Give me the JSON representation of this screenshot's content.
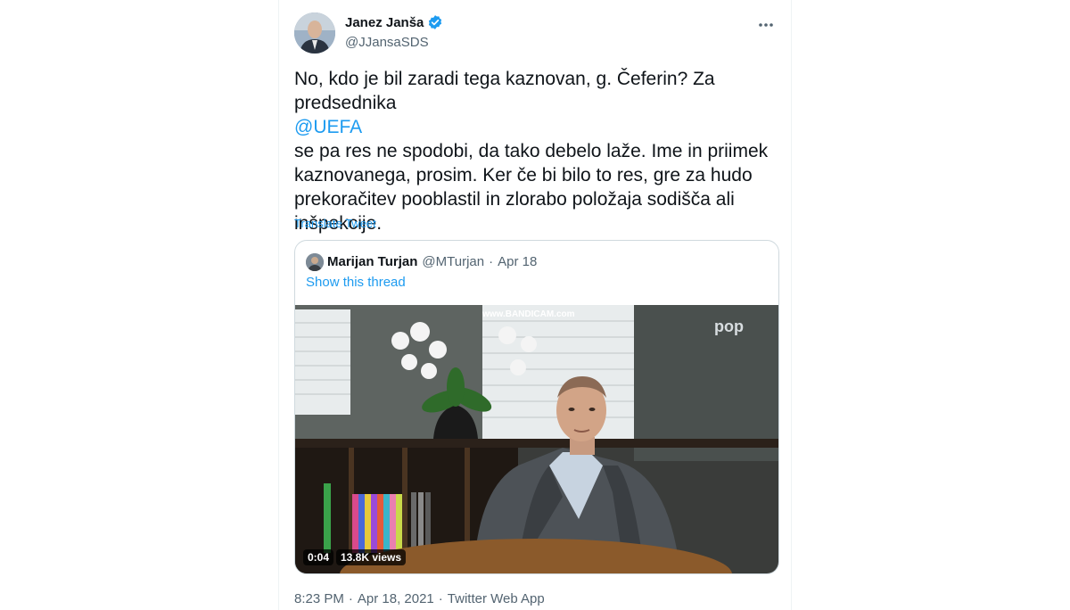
{
  "tweet": {
    "author_name": "Janez Janša",
    "author_handle": "@JJansaSDS",
    "text_before_mention": "No, kdo je bil zaradi tega kaznovan, g. Čeferin? Za predsednika ",
    "mention": "@UEFA",
    "text_after_mention": " se pa res ne spodobi, da tako debelo laže. Ime in priimek kaznovanega, prosim. Ker če bi bilo to res, gre za hudo prekoračitev pooblastil in zlorabo položaja sodišča ali inšpekcije.",
    "translate_label": "Translate Tweet",
    "time": "8:23 PM",
    "separator": "·",
    "date": "Apr 18, 2021",
    "source": "Twitter Web App"
  },
  "quote": {
    "author_name": "Marijan Turjan",
    "author_handle": "@MTurjan",
    "separator": "·",
    "date": "Apr 18",
    "show_thread": "Show this thread",
    "video": {
      "watermark": "www.BANDICAM.com",
      "channel_logo": "pop",
      "duration": "0:04",
      "views": "13.8K views"
    }
  },
  "icons": {
    "verified": "verified-badge-icon",
    "more": "more-options-icon"
  },
  "colors": {
    "accent": "#1d9bf0",
    "secondary_text": "#536471",
    "border": "#cfd9de"
  }
}
